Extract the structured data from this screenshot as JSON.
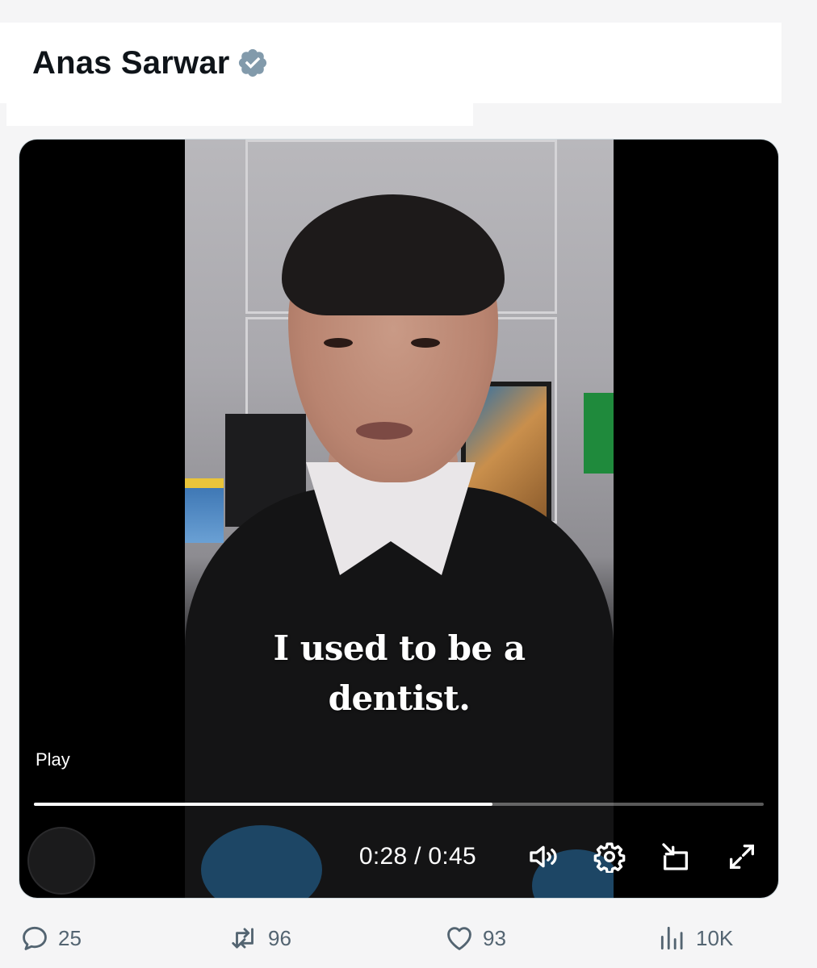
{
  "tweet": {
    "author_name": "Anas Sarwar",
    "verified_icon": "verified-badge-icon"
  },
  "video": {
    "caption_line1": "I used to be a",
    "caption_line2": "dentist.",
    "play_label": "Play",
    "current_time": "0:28",
    "time_separator": "/",
    "duration": "0:45",
    "progress": 0.628,
    "controls": [
      "volume-icon",
      "settings-icon",
      "picture-in-picture-icon",
      "fullscreen-icon"
    ]
  },
  "actions": {
    "replies": "25",
    "reposts": "96",
    "likes": "93",
    "views": "10K"
  },
  "colors": {
    "verified_badge": "#829aab",
    "action_gray": "#536471"
  }
}
